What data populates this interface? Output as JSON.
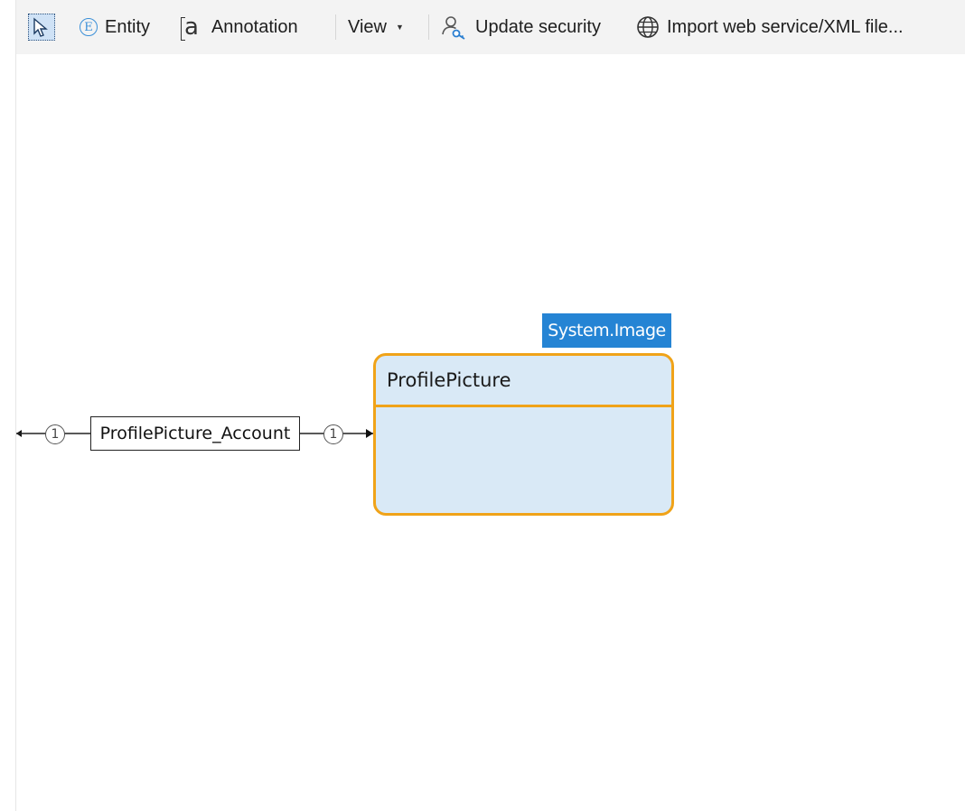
{
  "toolbar": {
    "select_icon": "select-pointer-icon",
    "entity_label": "Entity",
    "entity_icon_glyph": "E",
    "annotation_label": "Annotation",
    "annotation_icon_glyph": "a",
    "view_label": "View",
    "view_caret": "▼",
    "update_security_label": "Update security",
    "import_label": "Import web service/XML file..."
  },
  "diagram": {
    "association": {
      "name": "ProfilePicture_Account",
      "multiplicity_left": "1",
      "multiplicity_right": "1"
    },
    "entity": {
      "name": "ProfilePicture",
      "generalization": "System.Image",
      "border_color": "#f0a319",
      "fill_color": "#d9e9f6"
    },
    "generalization_color": "#2584d4"
  }
}
